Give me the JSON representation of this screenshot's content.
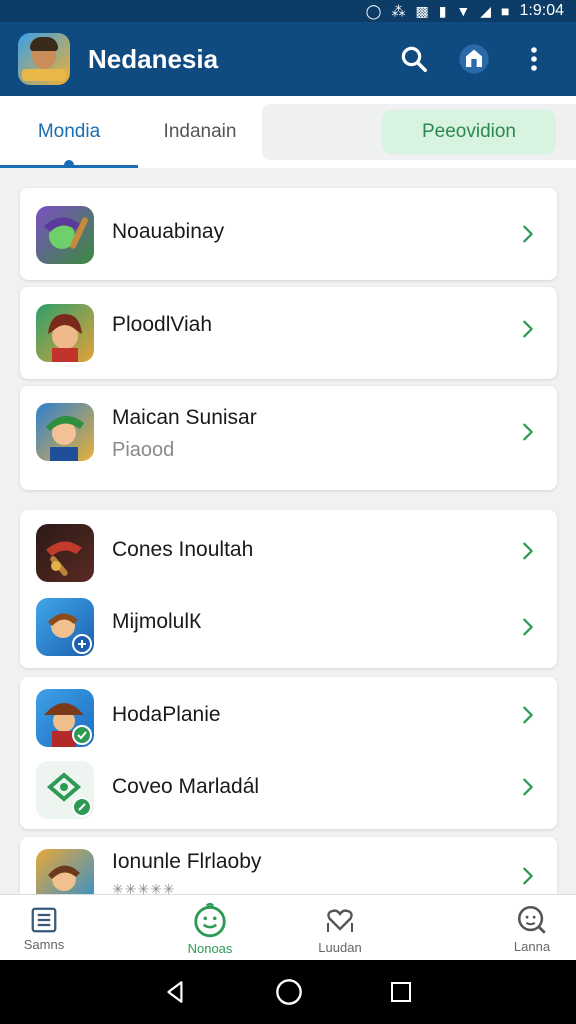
{
  "status_bar": {
    "time": "1:9:04",
    "icons": [
      "alarm-icon",
      "bluetooth-icon",
      "nfc-icon",
      "vibrate-icon",
      "wifi-icon",
      "signal-icon",
      "battery-icon"
    ]
  },
  "app_bar": {
    "title": "Nedanesia",
    "actions": [
      "search-icon",
      "store-icon",
      "more-vert-icon"
    ]
  },
  "tabs": [
    {
      "label": "Mondia",
      "active": true
    },
    {
      "label": "Indanain",
      "active": false
    },
    {
      "label": "Peeovidion",
      "active": false
    }
  ],
  "list": [
    {
      "title": "Noauabinay"
    },
    {
      "title": "PloodlViah"
    },
    {
      "title": "Maican Sunisar",
      "subtitle": "Piaood"
    },
    {
      "title": "Cones Inoultah"
    },
    {
      "title": "MijmolulК"
    },
    {
      "title": "HodaPlanie"
    },
    {
      "title": "Coveo Marladál"
    },
    {
      "title": "Ionunle Flrlaoby",
      "subtitle": "✳✳✳✳✳"
    }
  ],
  "bottom_nav": [
    {
      "label": "Samns",
      "icon": "list-icon",
      "active": false
    },
    {
      "label": "Nonoas",
      "icon": "smiley-icon",
      "active": true
    },
    {
      "label": "Luudan",
      "icon": "heart-hand-icon",
      "active": false
    },
    {
      "label": "Lanna",
      "icon": "search-face-icon",
      "active": false
    }
  ],
  "colors": {
    "app_bar": "#0f4a80",
    "status_bar": "#0d3c66",
    "accent_blue": "#1a6db3",
    "accent_green": "#2c9a55"
  }
}
